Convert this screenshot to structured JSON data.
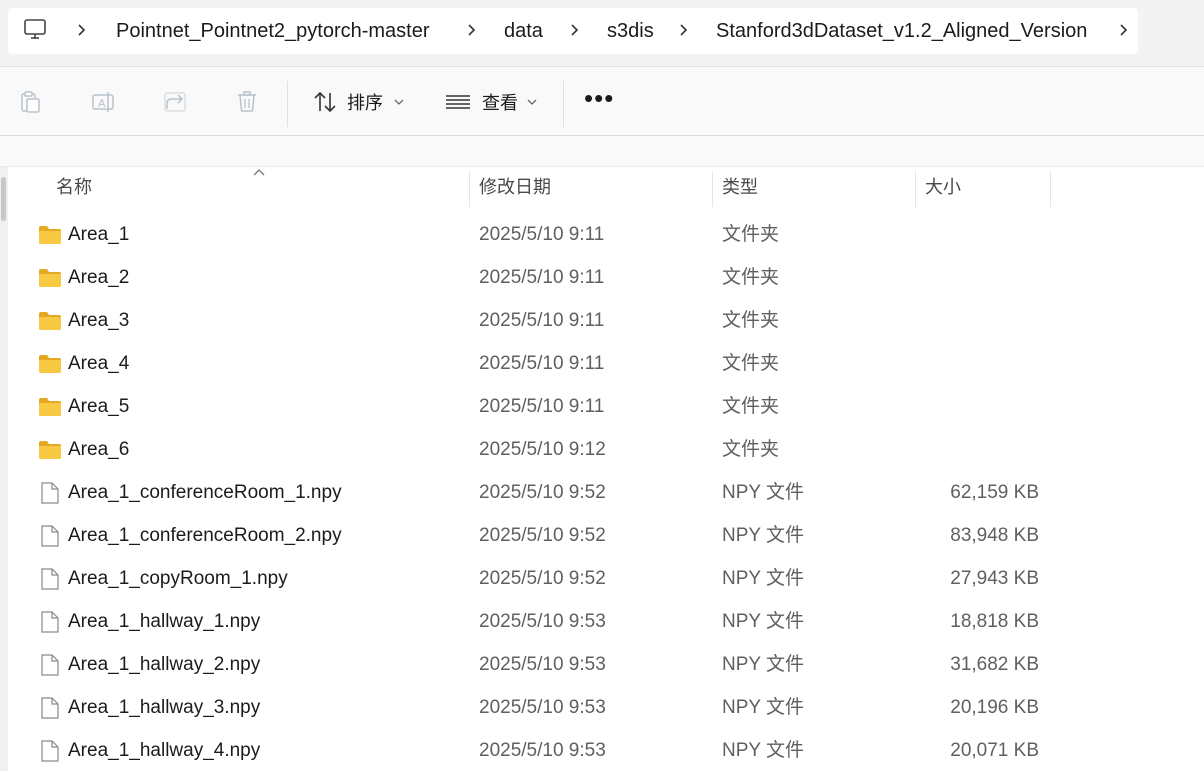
{
  "breadcrumb": {
    "root_icon": "computer-icon",
    "items": [
      "Pointnet_Pointnet2_pytorch-master",
      "data",
      "s3dis",
      "Stanford3dDataset_v1.2_Aligned_Version"
    ]
  },
  "toolbar": {
    "sort_label": "排序",
    "view_label": "查看",
    "more_label": "•••"
  },
  "columns": {
    "name": "名称",
    "date": "修改日期",
    "type": "类型",
    "size": "大小"
  },
  "files": [
    {
      "name": "Area_1",
      "date": "2025/5/10 9:11",
      "type": "文件夹",
      "size": "",
      "kind": "folder"
    },
    {
      "name": "Area_2",
      "date": "2025/5/10 9:11",
      "type": "文件夹",
      "size": "",
      "kind": "folder"
    },
    {
      "name": "Area_3",
      "date": "2025/5/10 9:11",
      "type": "文件夹",
      "size": "",
      "kind": "folder"
    },
    {
      "name": "Area_4",
      "date": "2025/5/10 9:11",
      "type": "文件夹",
      "size": "",
      "kind": "folder"
    },
    {
      "name": "Area_5",
      "date": "2025/5/10 9:11",
      "type": "文件夹",
      "size": "",
      "kind": "folder"
    },
    {
      "name": "Area_6",
      "date": "2025/5/10 9:12",
      "type": "文件夹",
      "size": "",
      "kind": "folder"
    },
    {
      "name": "Area_1_conferenceRoom_1.npy",
      "date": "2025/5/10 9:52",
      "type": "NPY 文件",
      "size": "62,159 KB",
      "kind": "file"
    },
    {
      "name": "Area_1_conferenceRoom_2.npy",
      "date": "2025/5/10 9:52",
      "type": "NPY 文件",
      "size": "83,948 KB",
      "kind": "file"
    },
    {
      "name": "Area_1_copyRoom_1.npy",
      "date": "2025/5/10 9:52",
      "type": "NPY 文件",
      "size": "27,943 KB",
      "kind": "file"
    },
    {
      "name": "Area_1_hallway_1.npy",
      "date": "2025/5/10 9:53",
      "type": "NPY 文件",
      "size": "18,818 KB",
      "kind": "file"
    },
    {
      "name": "Area_1_hallway_2.npy",
      "date": "2025/5/10 9:53",
      "type": "NPY 文件",
      "size": "31,682 KB",
      "kind": "file"
    },
    {
      "name": "Area_1_hallway_3.npy",
      "date": "2025/5/10 9:53",
      "type": "NPY 文件",
      "size": "20,196 KB",
      "kind": "file"
    },
    {
      "name": "Area_1_hallway_4.npy",
      "date": "2025/5/10 9:53",
      "type": "NPY 文件",
      "size": "20,071 KB",
      "kind": "file"
    }
  ],
  "colors": {
    "folder": "#f8c942",
    "folder_dark": "#e5a823",
    "file_outline": "#8a8a8a"
  }
}
